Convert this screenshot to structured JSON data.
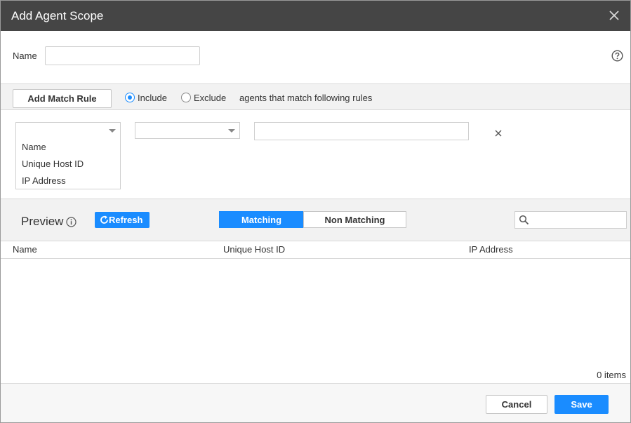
{
  "dialog": {
    "title": "Add Agent Scope",
    "close_icon": "close-icon",
    "help_icon": "question-circle-icon"
  },
  "name_field": {
    "label": "Name",
    "value": "",
    "placeholder": ""
  },
  "rule_bar": {
    "add_rule_label": "Add Match Rule",
    "include_label": "Include",
    "exclude_label": "Exclude",
    "selected_mode": "Include",
    "rule_text": "agents that match following rules"
  },
  "rule_row": {
    "field_select_value": "",
    "operator_select_value": "",
    "value_input": "",
    "remove_icon": "close-icon",
    "field_options": [
      "Name",
      "Unique Host ID",
      "IP Address"
    ]
  },
  "preview": {
    "title": "Preview",
    "info_icon": "info-circle-icon",
    "refresh_label": "Refresh",
    "refresh_icon": "refresh-icon",
    "tabs": [
      {
        "label": "Matching",
        "active": true
      },
      {
        "label": "Non Matching",
        "active": false
      }
    ],
    "search_icon": "search-icon",
    "search_value": ""
  },
  "table": {
    "columns": [
      "Name",
      "Unique Host ID",
      "IP Address"
    ],
    "rows": [],
    "items_count": "0 items"
  },
  "footer": {
    "cancel_label": "Cancel",
    "save_label": "Save"
  },
  "colors": {
    "titlebar": "#454545",
    "accent": "#1a8cff"
  }
}
